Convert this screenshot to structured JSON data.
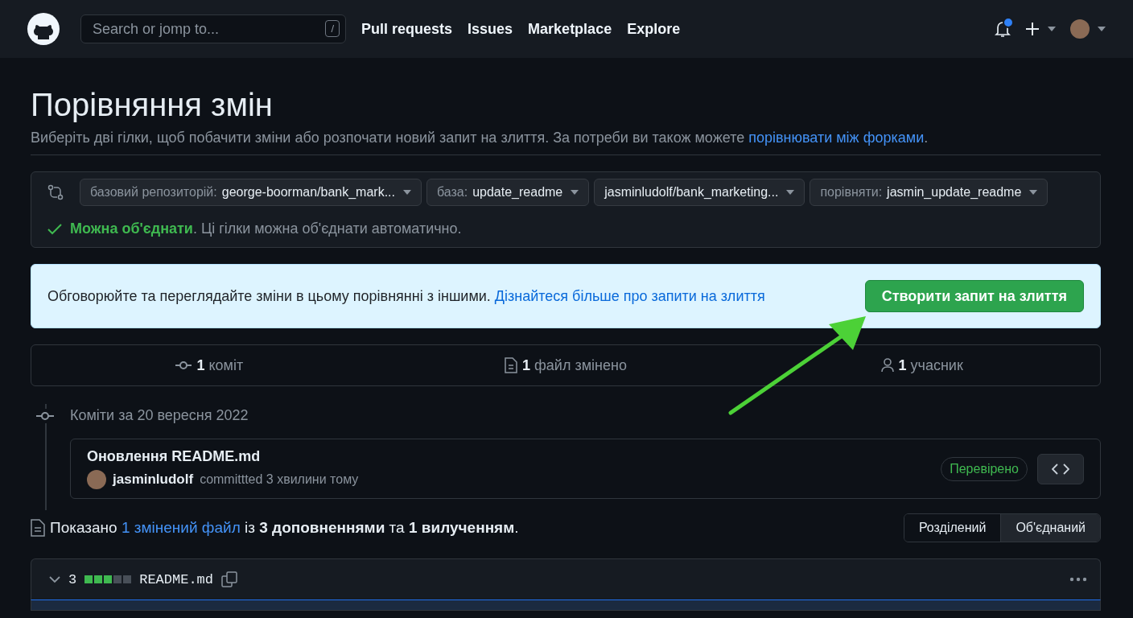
{
  "header": {
    "search_placeholder": "Search or jomp to...",
    "search_key": "/",
    "nav": [
      "Pull requests",
      "Issues",
      "Marketplace",
      "Explore"
    ],
    "notification_unread": true
  },
  "page": {
    "title": "Порівняння змін",
    "subtitle": {
      "text": "Виберіть дві гілки, щоб побачити зміни або розпочати новий запит на злиття. За потреби ви також можете ",
      "link": "порівнювати між форками",
      "after": "."
    }
  },
  "compare": {
    "selectors": [
      {
        "prefix": "базовий репозиторій:",
        "value": "george-boorman/bank_mark..."
      },
      {
        "prefix": "база:",
        "value": "update_readme"
      },
      {
        "value": "jasminludolf/bank_marketing..."
      },
      {
        "prefix": "порівняти:",
        "value": "jasmin_update_readme"
      }
    ],
    "status": "**Можна об'єднати**. Ці гілки можна об'єднати автоматично."
  },
  "banner": {
    "text": "Обговорюйте та переглядайте зміни в цьому порівнянні з іншими.",
    "link": "Дізнайтеся більше про запити на злиття",
    "button": "Створити запит на злиття"
  },
  "stats": [
    {
      "kind": "commit",
      "count": "1",
      "label": "коміт"
    },
    {
      "kind": "file",
      "count": "1",
      "label": "файл змінено"
    },
    {
      "kind": "person",
      "count": "1",
      "label": "учасник"
    }
  ],
  "commits": {
    "date": "Коміти за 20 вересня 2022",
    "items": [
      {
        "title": "Оновлення README.md",
        "author": "jasminludolf",
        "meta": "committted 3 хвилини тому",
        "badge": "Перевірено"
      }
    ]
  },
  "summary": {
    "before": "Показано ",
    "link": "1 змінений файл",
    "after": " із **3 доповненнями** та **1 вилученням**."
  },
  "view_modes": [
    {
      "label": "Розділений",
      "selected": true
    },
    {
      "label": "Об'єднаний",
      "selected": false
    }
  ],
  "file": {
    "changes": "3",
    "diffstat": [
      {
        "kind": "added"
      },
      {
        "kind": "added"
      },
      {
        "kind": "added"
      },
      {
        "kind": "neutral"
      },
      {
        "kind": "neutral"
      }
    ],
    "name": "README.md"
  }
}
